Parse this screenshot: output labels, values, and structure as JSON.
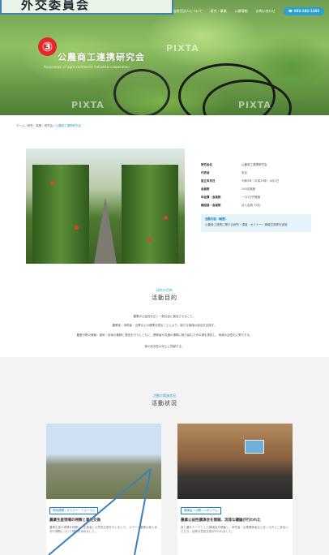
{
  "callout": {
    "label": "外交委員会"
  },
  "nav": {
    "items": [
      "公益財団法人について",
      "研究・事業",
      "公募情報",
      "お問い合わせ"
    ],
    "tel": "033-182-1193"
  },
  "hero": {
    "badge": "③",
    "title": "公農商工連携研究会",
    "subtitle": "Association of agro-commerce industrial cooperation",
    "watermark": "PIXTA"
  },
  "breadcrumb": {
    "path": "ホーム / 研究・事業 / 研究会 / ",
    "current": "公農商工連携研究会"
  },
  "info": {
    "rows": [
      {
        "k": "研究会名",
        "v": "公農商工連携研究会"
      },
      {
        "k": "代表者",
        "v": "未定"
      },
      {
        "k": "設立年月日",
        "v": "令和5年（平成29年）4月1日"
      },
      {
        "k": "会員数",
        "v": "100名程度"
      },
      {
        "k": "年会費・会員数",
        "v": "一口1万円程度"
      },
      {
        "k": "構成員・会員数",
        "v": "法人会員 70社"
      }
    ],
    "box_title": "活動内容（概要）",
    "box_desc": "公農商工連携に関する研究・調査・セミナー・情報交換等を実施"
  },
  "purpose": {
    "kicker": "研究の目的",
    "title": "活動目的",
    "lines": [
      "農業の公益性を広く一般社会に普及させること。",
      "農業者・消費者・企業などの連携を図ることにより、新たな価値の創出を目指す。",
      "農業分野の情報・事例・技術の集積と発信を行うとともに、関係者が共通の課題に取り組むための場を提供し、地域の活性化に寄与する。",
      "食の安全性の向上に貢献する。"
    ]
  },
  "activity": {
    "kicker": "活動の実施状況",
    "title": "活動状況",
    "cards": [
      {
        "tag": "現地視察 / セミナー・フォーラム",
        "title": "農業生産現場の視察と意見交換",
        "desc": "農業生産の現場を視察し、生産者との意見交換を行いました。スマート農業の導入状況や課題について理解を深めました。"
      },
      {
        "tag": "講演会 / 公開シンポジウム",
        "title": "農業公益性講演会を開催、活発な議論が行われた",
        "desc": "食と農をテーマとした講演会を開催し、研究者・企業関係者など多くの方にご参加いただき、活発な意見交換が行われました。"
      }
    ]
  },
  "colors": {
    "accent": "#2aa1d6",
    "callout_border": "#3d7fb8",
    "badge": "#e6262a"
  }
}
